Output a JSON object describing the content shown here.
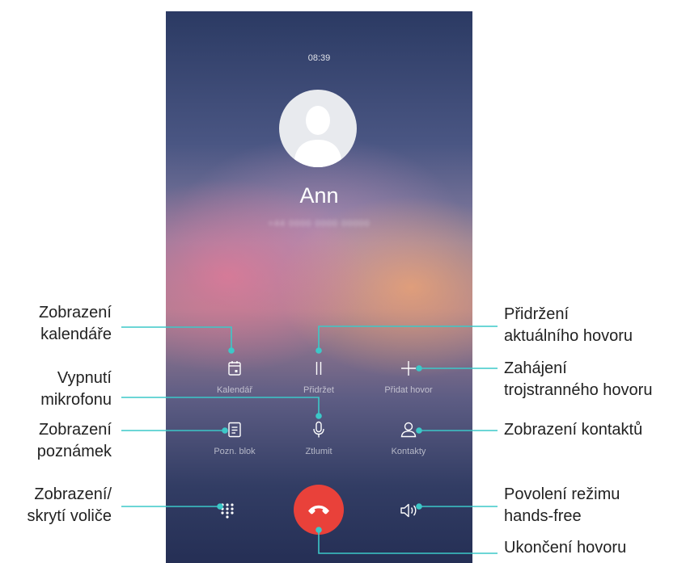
{
  "status": {
    "time": "08:39"
  },
  "contact": {
    "name": "Ann",
    "number": "+44 0000 0000 00000"
  },
  "buttons": {
    "calendar": "Kalendář",
    "hold": "Přidržet",
    "add_call": "Přidat hovor",
    "notepad": "Pozn. blok",
    "mute": "Ztlumit",
    "contacts": "Kontakty"
  },
  "callouts": {
    "calendar": [
      "Zobrazení",
      "kalendáře"
    ],
    "mute": [
      "Vypnutí",
      "mikrofonu"
    ],
    "notes": [
      "Zobrazení",
      "poznámek"
    ],
    "dialpad": [
      "Zobrazení/",
      "skrytí voliče"
    ],
    "hold": [
      "Přidržení",
      "aktuálního hovoru"
    ],
    "add_call": [
      "Zahájení",
      "trojstranného hovoru"
    ],
    "contacts": [
      "Zobrazení kontaktů"
    ],
    "speaker": [
      "Povolení režimu",
      "hands-free"
    ],
    "end_call": [
      "Ukončení hovoru"
    ]
  },
  "colors": {
    "leader_line": "#3cc8c8",
    "end_call": "#e9413a"
  },
  "icons": {
    "calendar": "calendar-icon",
    "hold": "pause-icon",
    "add_call": "plus-icon",
    "notepad": "note-icon",
    "mute": "microphone-icon",
    "contacts": "person-icon",
    "dialpad": "dialpad-icon",
    "end_call": "phone-hangup-icon",
    "speaker": "speaker-icon"
  }
}
